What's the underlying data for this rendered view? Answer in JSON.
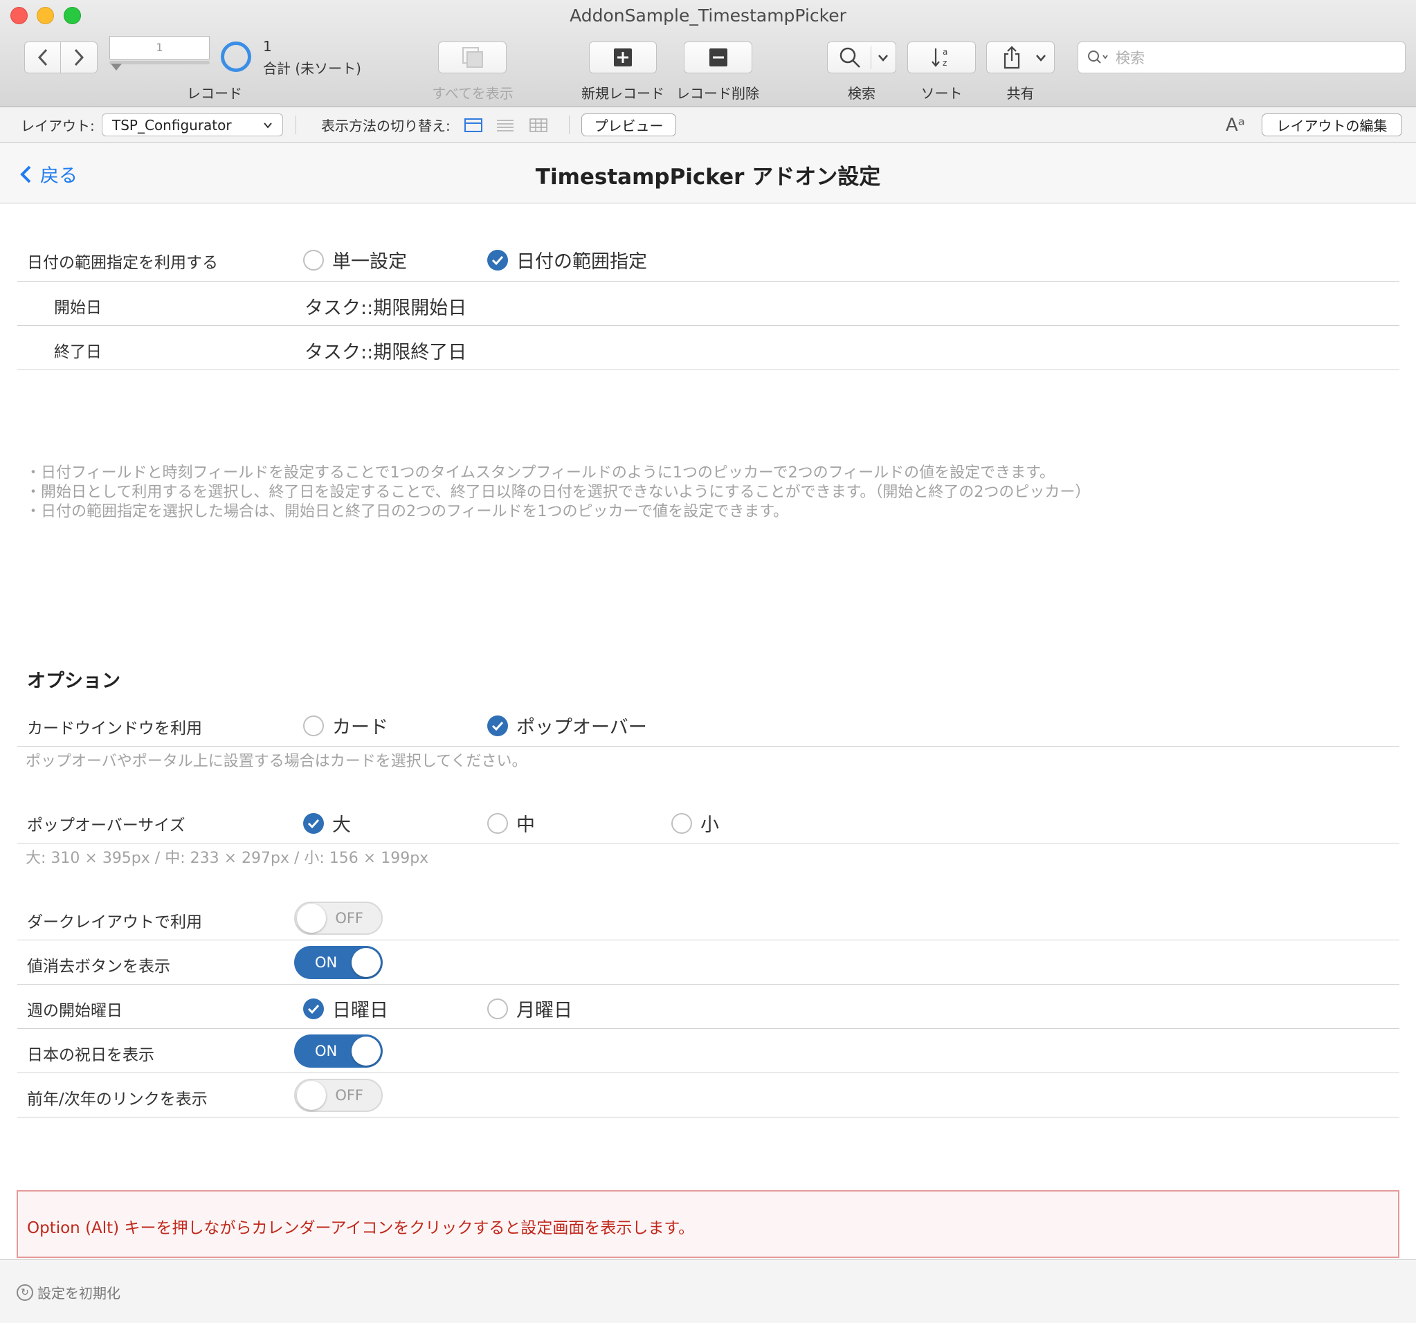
{
  "window": {
    "title": "AddonSample_TimestampPicker"
  },
  "toolbar": {
    "record_number": "1",
    "record_count": "1",
    "record_total_text": "合計 (未ソート)",
    "record_label": "レコード",
    "show_all_label": "すべてを表示",
    "new_record_label": "新規レコード",
    "delete_record_label": "レコード削除",
    "find_label": "検索",
    "sort_label": "ソート",
    "share_label": "共有",
    "search_placeholder": "検索"
  },
  "layoutbar": {
    "layout_label": "レイアウト:",
    "layout_value": "TSP_Configurator",
    "view_switch_label": "表示方法の切り替え:",
    "active_view": "form",
    "preview_label": "プレビュー",
    "text_size_glyph": "Aᵃ",
    "edit_layout_label": "レイアウトの編集"
  },
  "header": {
    "back_label": "戻る",
    "title": "TimestampPicker アドオン設定"
  },
  "date_range": {
    "label": "日付の範囲指定を利用する",
    "options": [
      {
        "label": "単一設定",
        "checked": false
      },
      {
        "label": "日付の範囲指定",
        "checked": true
      }
    ],
    "start_label": "開始日",
    "start_value": "タスク::期限開始日",
    "end_label": "終了日",
    "end_value": "タスク::期限終了日"
  },
  "notes": [
    "・日付フィールドと時刻フィールドを設定することで1つのタイムスタンプフィールドのように1つのピッカーで2つのフィールドの値を設定できます。",
    "・開始日として利用するを選択し、終了日を設定することで、終了日以降の日付を選択できないようにすることができます。（開始と終了の2つのピッカー）",
    "・日付の範囲指定を選択した場合は、開始日と終了日の2つのフィールドを1つのピッカーで値を設定できます。"
  ],
  "options": {
    "heading": "オプション",
    "card_window": {
      "label": "カードウインドウを利用",
      "options": [
        {
          "label": "カード",
          "checked": false
        },
        {
          "label": "ポップオーバー",
          "checked": true
        }
      ],
      "note": "ポップオーバやポータル上に設置する場合はカードを選択してください。"
    },
    "popover_size": {
      "label": "ポップオーバーサイズ",
      "options": [
        {
          "label": "大",
          "checked": true
        },
        {
          "label": "中",
          "checked": false
        },
        {
          "label": "小",
          "checked": false
        }
      ],
      "note": "大: 310 × 395px / 中: 233 × 297px / 小: 156 × 199px"
    },
    "dark_layout": {
      "label": "ダークレイアウトで利用",
      "state": "OFF"
    },
    "clear_button": {
      "label": "値消去ボタンを表示",
      "state": "ON"
    },
    "week_start": {
      "label": "週の開始曜日",
      "options": [
        {
          "label": "日曜日",
          "checked": true
        },
        {
          "label": "月曜日",
          "checked": false
        }
      ]
    },
    "japanese_holidays": {
      "label": "日本の祝日を表示",
      "state": "ON"
    },
    "year_links": {
      "label": "前年/次年のリンクを表示",
      "state": "OFF"
    }
  },
  "alt_notice": "Option (Alt) キーを押しながらカレンダーアイコンをクリックすると設定画面を表示します。",
  "footer": {
    "reset_label": "設定を初期化"
  },
  "colors": {
    "accent_blue": "#2f6fb6",
    "link_blue": "#1f7bf0",
    "notice_red": "#c0281c"
  }
}
